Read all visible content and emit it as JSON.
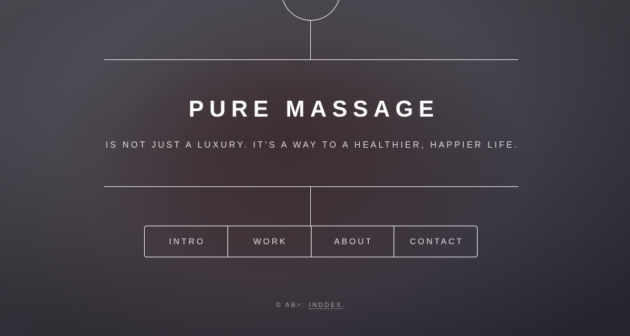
{
  "header": {
    "title": "PURE MASSAGE",
    "subtitle": "IS NOT JUST A LUXURY. IT’S A WAY TO A HEALTHIER, HAPPIER LIFE."
  },
  "nav": {
    "items": [
      {
        "label": "INTRO"
      },
      {
        "label": "WORK"
      },
      {
        "label": "ABOUT"
      },
      {
        "label": "CONTACT"
      }
    ]
  },
  "footer": {
    "prefix": "© AB>: ",
    "link_label": "INDDEX",
    "suffix": "."
  },
  "colors": {
    "text": "#ffffff",
    "background_top": "#5a5a64",
    "background_bottom": "#2f2f3d"
  }
}
